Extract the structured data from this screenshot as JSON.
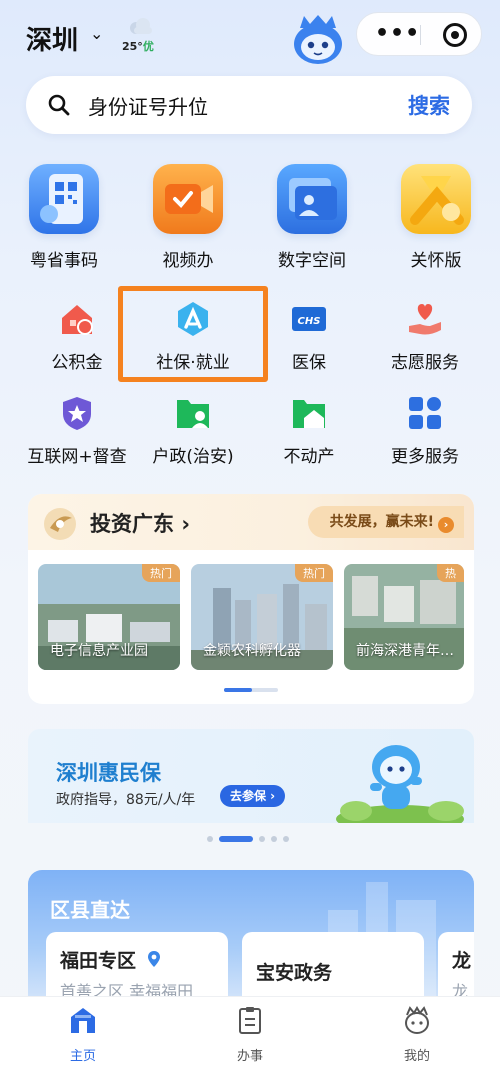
{
  "header": {
    "city": "深圳",
    "city_arrow": "⌄",
    "weather": {
      "temp": "25°",
      "aqi": "优"
    },
    "more": "•••"
  },
  "search": {
    "query": "身份证号升位",
    "button": "搜索"
  },
  "top_services": [
    {
      "label": "粤省事码",
      "icon": "qr-code-icon"
    },
    {
      "label": "视频办",
      "icon": "video-icon"
    },
    {
      "label": "数字空间",
      "icon": "folder-icon"
    },
    {
      "label": "关怀版",
      "icon": "ribbon-icon"
    }
  ],
  "services_row1": [
    {
      "label": "公积金",
      "icon": "house-fund-icon"
    },
    {
      "label": "社保·就业",
      "icon": "social-security-icon"
    },
    {
      "label": "医保",
      "icon": "medical-insurance-icon",
      "badge": "CHS"
    },
    {
      "label": "志愿服务",
      "icon": "volunteer-icon"
    }
  ],
  "services_row2": [
    {
      "label": "互联网+督查",
      "icon": "shield-star-icon"
    },
    {
      "label": "户政(治安)",
      "icon": "household-icon"
    },
    {
      "label": "不动产",
      "icon": "real-estate-icon"
    },
    {
      "label": "更多服务",
      "icon": "grid-icon"
    }
  ],
  "invest": {
    "title": "投资广东",
    "arrow": "›",
    "slogan": "共发展，赢未来!",
    "slogan_arrow": "›",
    "items": [
      {
        "caption": "电子信息产业园",
        "tag": "热门"
      },
      {
        "caption": "金颖农科孵化器",
        "tag": "热门"
      },
      {
        "caption": "前海深港青年…",
        "tag": "热"
      }
    ]
  },
  "insurance": {
    "title": "深圳惠民保",
    "subtitle": "政府指导，88元/人/年",
    "cta": "去参保 ›"
  },
  "district": {
    "title": "区县直达",
    "cards": [
      {
        "name": "福田专区",
        "sub": "首善之区 幸福福田"
      },
      {
        "name": "宝安政务",
        "sub": ""
      },
      {
        "name": "龙",
        "sub": "龙"
      }
    ]
  },
  "tabbar": [
    {
      "label": "主页",
      "active": true
    },
    {
      "label": "办事",
      "active": false
    },
    {
      "label": "我的",
      "active": false
    }
  ],
  "colors": {
    "accent": "#2c6be4",
    "highlight": "#f5821f"
  }
}
